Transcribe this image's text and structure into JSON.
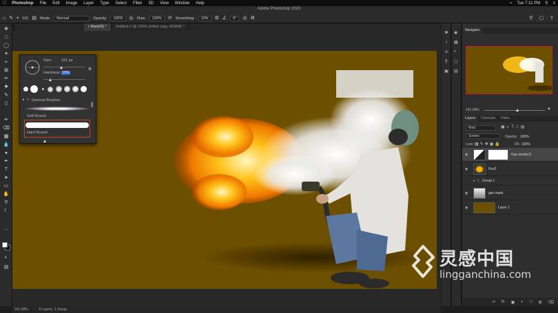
{
  "menubar": {
    "apple": "",
    "items": [
      "Photoshop",
      "File",
      "Edit",
      "Image",
      "Layer",
      "Type",
      "Select",
      "Filter",
      "3D",
      "View",
      "Window",
      "Help"
    ],
    "clock": "Tue 7:11 PM"
  },
  "window_title": "Adobe Photoshop 2020",
  "options": {
    "brush_size": "101",
    "mode_label": "Mode:",
    "mode_value": "Normal",
    "opacity_label": "Opacity:",
    "opacity_value": "100%",
    "flow_label": "Flow:",
    "flow_value": "100%",
    "smoothing_label": "Smoothing:",
    "smoothing_value": "10%",
    "angle_value": "0°"
  },
  "tabs": [
    {
      "label": "r Mask/8) *",
      "active": true
    },
    {
      "label": "Untitled-2 @ 126% (Initial copy, RGB/8) *",
      "active": false
    }
  ],
  "brush_popup": {
    "size_label": "Size:",
    "size_value": "101 px",
    "hardness_label": "Hardness:",
    "hardness_value": "15%",
    "folder_label": "General Brushes",
    "preset_soft": "Soft Round",
    "preset_hard": "Hard Round"
  },
  "navigator": {
    "tab": "Navigator",
    "zoom": "161.58%"
  },
  "layers_panel": {
    "tabs": [
      "Layers",
      "Channels",
      "Paths"
    ],
    "filter_label": "Kind",
    "blend_mode": "Screen",
    "opacity_label": "Opacity:",
    "opacity_value": "100%",
    "lock_label": "Lock:",
    "fill_label": "Fill:",
    "fill_value": "100%",
    "layers": [
      {
        "name": "Gas smoke/1",
        "active": true
      },
      {
        "name": "Fire2",
        "active": false
      },
      {
        "name": "Group 1",
        "active": false
      },
      {
        "name": "gas mask",
        "active": false
      },
      {
        "name": "Layer 1",
        "active": false
      }
    ]
  },
  "status": {
    "zoom": "161.58%",
    "info": "6 Layers, 1 Group"
  },
  "watermark": {
    "cn": "灵感中国",
    "en": "lingganchina.com"
  },
  "colors": {
    "canvas_bg": "#6d4f00",
    "ui_dark": "#2b2b2b",
    "selection_red": "#c02020"
  }
}
